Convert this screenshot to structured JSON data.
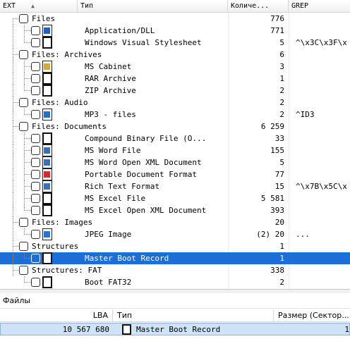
{
  "columns": {
    "ext": "EXT",
    "type": "Тип",
    "count": "Количе...",
    "grep": "GREP"
  },
  "sort_indicator": "▲",
  "rows": [
    {
      "label": "Files",
      "count": "776",
      "grep": "",
      "level": 0
    },
    {
      "label": "Application/DLL",
      "count": "771",
      "grep": "",
      "level": 1,
      "icon": "app-icon"
    },
    {
      "label": "Windows Visual Stylesheet",
      "count": "5",
      "grep": "^\\x3C\\x3F\\x",
      "level": 1,
      "icon": "file-icon"
    },
    {
      "label": "Files: Archives",
      "count": "6",
      "grep": "",
      "level": 0
    },
    {
      "label": "MS Cabinet",
      "count": "3",
      "grep": "",
      "level": 1,
      "icon": "cabinet-icon"
    },
    {
      "label": "RAR Archive",
      "count": "1",
      "grep": "",
      "level": 1,
      "icon": "file-icon"
    },
    {
      "label": "ZIP Archive",
      "count": "2",
      "grep": "",
      "level": 1,
      "icon": "file-icon"
    },
    {
      "label": "Files: Audio",
      "count": "2",
      "grep": "",
      "level": 0
    },
    {
      "label": "MP3 - files",
      "count": "2",
      "grep": "^ID3",
      "level": 1,
      "icon": "audio-icon"
    },
    {
      "label": "Files: Documents",
      "count": "6 259",
      "grep": "",
      "level": 0
    },
    {
      "label": "Compound Binary File (O...",
      "count": "33",
      "grep": "",
      "level": 1,
      "icon": "file-icon"
    },
    {
      "label": "MS Word File",
      "count": "155",
      "grep": "",
      "level": 1,
      "icon": "word-icon"
    },
    {
      "label": "MS Word Open XML Document",
      "count": "5",
      "grep": "",
      "level": 1,
      "icon": "word-icon"
    },
    {
      "label": "Portable Document Format",
      "count": "77",
      "grep": "",
      "level": 1,
      "icon": "pdf-icon"
    },
    {
      "label": "Rich Text Format",
      "count": "15",
      "grep": "^\\x7B\\x5C\\x",
      "level": 1,
      "icon": "word-icon"
    },
    {
      "label": "MS Excel File",
      "count": "5 581",
      "grep": "",
      "level": 1,
      "icon": "file-icon"
    },
    {
      "label": "MS Excel Open XML Document",
      "count": "393",
      "grep": "",
      "level": 1,
      "icon": "file-icon"
    },
    {
      "label": "Files: Images",
      "count": "20",
      "grep": "",
      "level": 0
    },
    {
      "label": "JPEG Image",
      "count": "(2) 20",
      "grep": "...",
      "level": 1,
      "icon": "image-icon"
    },
    {
      "label": "Structures",
      "count": "1",
      "grep": "",
      "level": 0
    },
    {
      "label": "Master Boot Record",
      "count": "1",
      "grep": "",
      "level": 1,
      "icon": "file-icon",
      "selected": true
    },
    {
      "label": "Structures: FAT",
      "count": "338",
      "grep": "",
      "level": 0
    },
    {
      "label": "Boot FAT32",
      "count": "2",
      "grep": "",
      "level": 1,
      "icon": "file-icon"
    }
  ],
  "files_panel": {
    "title": "Файлы",
    "columns": {
      "lba": "LBA",
      "type": "Тип",
      "size": "Размер (Сектор..."
    },
    "row": {
      "lba": "10 567 680",
      "type": "Master Boot Record",
      "size": "1"
    }
  },
  "colors": {
    "selection": "#1b6fd6",
    "panel_selection": "#cde3f8"
  }
}
